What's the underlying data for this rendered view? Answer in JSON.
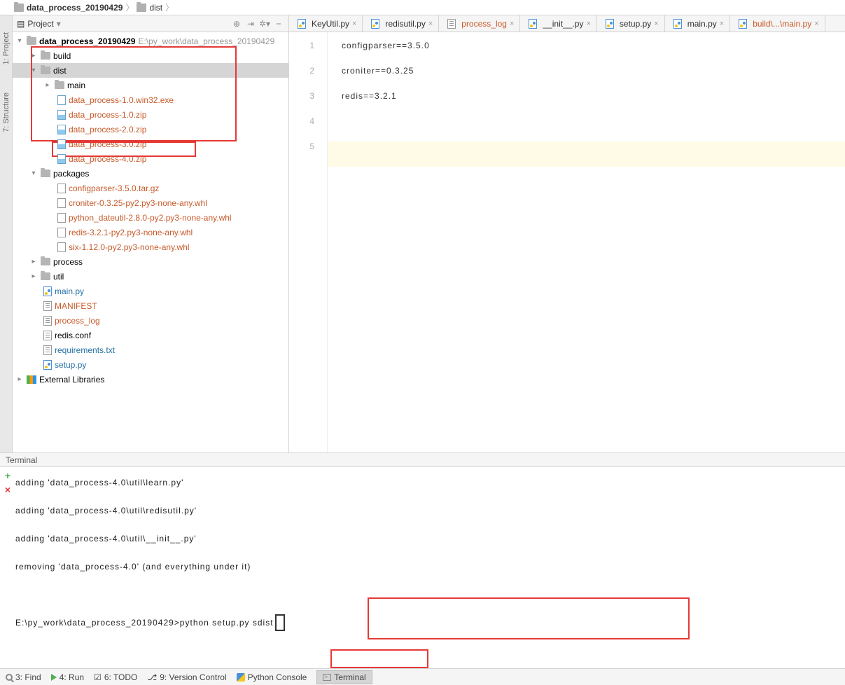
{
  "breadcrumb": {
    "root": "data_process_20190429",
    "second": "dist"
  },
  "project_panel": {
    "title": "Project",
    "root": "data_process_20190429",
    "root_path": "E:\\py_work\\data_process_20190429",
    "build": "build",
    "dist": "dist",
    "main": "main",
    "dist_files": {
      "exe": "data_process-1.0.win32.exe",
      "z10": "data_process-1.0.zip",
      "z20": "data_process-2.0.zip",
      "z30": "data_process-3.0.zip",
      "z40": "data_process-4.0.zip"
    },
    "packages": "packages",
    "pkg_files": {
      "cfg": "configparser-3.5.0.tar.gz",
      "cron": "croniter-0.3.25-py2.py3-none-any.whl",
      "dateutil": "python_dateutil-2.8.0-py2.py3-none-any.whl",
      "redis": "redis-3.2.1-py2.py3-none-any.whl",
      "six": "six-1.12.0-py2.py3-none-any.whl"
    },
    "process": "process",
    "util": "util",
    "mainpy": "main.py",
    "manifest": "MANIFEST",
    "plog": "process_log",
    "redisconf": "redis.conf",
    "reqs": "requirements.txt",
    "setup": "setup.py",
    "ext": "External Libraries"
  },
  "left_rail": {
    "proj": "1: Project",
    "struct": "7: Structure"
  },
  "tabs": {
    "t0": "KeyUtil.py",
    "t1": "redisutil.py",
    "t2": "process_log",
    "t3": "__init__.py",
    "t4": "setup.py",
    "t5": "main.py",
    "t6": "build\\...\\main.py"
  },
  "editor": {
    "l1": "configparser==3.5.0",
    "l2": "croniter==0.3.25",
    "l3": "redis==3.2.1",
    "ln1": "1",
    "ln2": "2",
    "ln3": "3",
    "ln4": "4",
    "ln5": "5"
  },
  "terminal": {
    "title": "Terminal",
    "o0": "adding 'data_process-4.0\\util\\learn.py'",
    "o1": "adding 'data_process-4.0\\util\\redisutil.py'",
    "o2": "adding 'data_process-4.0\\util\\__init__.py'",
    "o3": "removing 'data_process-4.0' (and everything under it)",
    "prompt": "E:\\py_work\\data_process_20190429>python setup.py sdist"
  },
  "bottom": {
    "find": "3: Find",
    "run": "4: Run",
    "todo": "6: TODO",
    "vcs": "9: Version Control",
    "pyc": "Python Console",
    "term": "Terminal"
  }
}
